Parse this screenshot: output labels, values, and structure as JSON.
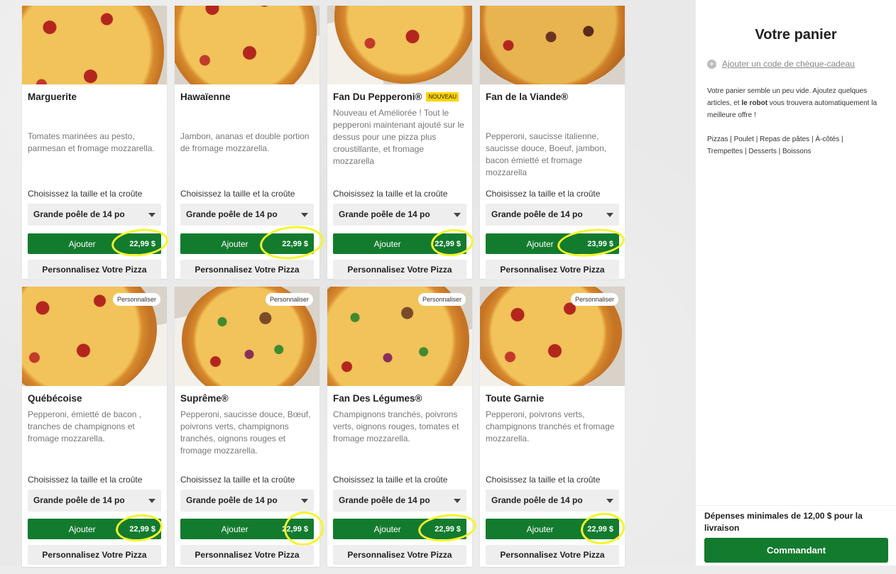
{
  "menu": {
    "size_label": "Choisissez la taille et la croûte",
    "size_value": "Grande poêle de 14 po",
    "add_label": "Ajouter",
    "customize_label": "Personnalisez Votre Pizza",
    "customize_badge": "Personnaliser",
    "new_badge": "NOUVEAU",
    "items": [
      {
        "name": "Marguerite",
        "desc": "Tomates marinées au pesto, parmesan et fromage mozzarella.",
        "price": "22,99 $"
      },
      {
        "name": "Hawaïenne",
        "desc": "Jambon, ananas et double portion de fromage mozzarella.",
        "price": "22,99 $"
      },
      {
        "name": "Fan Du Pepperoni®",
        "desc": "Nouveau et Améliorée ! Tout le pepperoni maintenant ajouté sur le dessus pour une pizza plus croustillante, et fromage mozzarella",
        "price": "22,99 $"
      },
      {
        "name": "Fan de la Viande®",
        "desc": "Pepperoni, saucisse italienne, saucisse douce, Boeuf, jambon, bacon émietté et fromage mozzarella",
        "price": "23,99 $"
      },
      {
        "name": "Québécoise",
        "desc": "Pepperoni, émietté de bacon , tranches de champignons et fromage mozzarella.",
        "price": "22,99 $"
      },
      {
        "name": "Suprême®",
        "desc": "Pepperoni, saucisse douce, Bœuf, poivrons verts, champignons tranchés, oignons rouges et fromage mozzarella.",
        "price": "22,99 $"
      },
      {
        "name": "Fan Des Légumes®",
        "desc": "Champignons tranchés, poivrons verts, oignons rouges, tomates et fromage mozzarella.",
        "price": "22,99 $"
      },
      {
        "name": "Toute Garnie",
        "desc": "Pepperoni, poivrons verts, champignons tranchés et fromage mozzarella.",
        "price": "22,99 $"
      }
    ]
  },
  "cart": {
    "title": "Votre panier",
    "gift_link": "Ajouter un code de chèque-cadeau",
    "empty_prefix": "Votre panier semble un peu vide. Ajoutez quelques articles, et ",
    "empty_bold": "le robot",
    "empty_suffix": " vous trouvera automatiquement la meilleure offre !",
    "categories": [
      "Pizzas",
      "Poulet",
      "Repas de pâtes",
      "À-côtés",
      "Trempettes",
      "Desserts",
      "Boissons"
    ],
    "min_text": "Dépenses minimales de 12,00 $ pour la livraison",
    "order_label": "Commandant"
  },
  "colors": {
    "brand_green": "#137b2e",
    "highlight": "#f5f52a",
    "badge_yellow": "#ffd200"
  }
}
